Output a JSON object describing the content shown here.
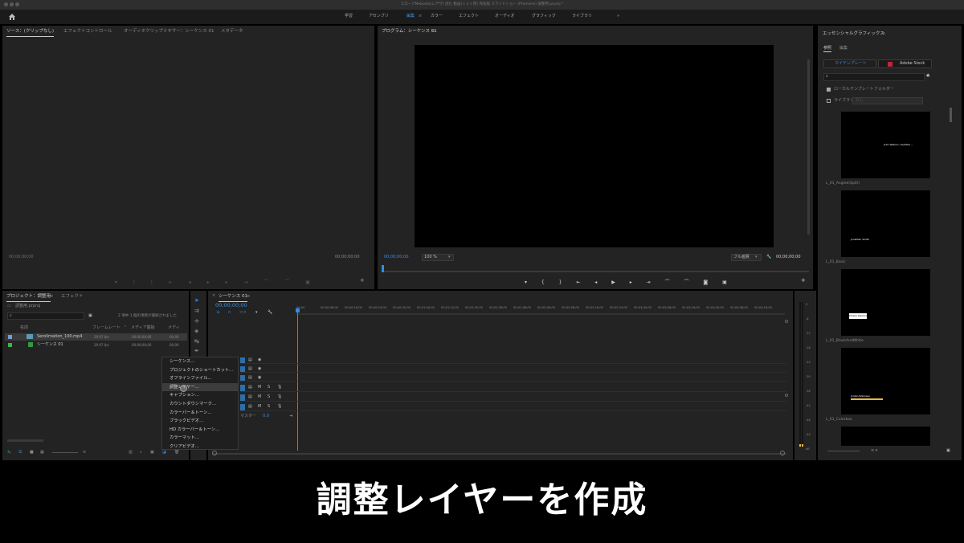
{
  "titlebar": {
    "title": "スローアMebodia(レデザ) 読む 動画(ｓｎｓ用) 完成版 スライドショー (Premiere) 調整用.prproj *"
  },
  "workspaces": {
    "items": [
      "学習",
      "アセンブリ",
      "編集",
      "カラー",
      "エフェクト",
      "オーディオ",
      "グラフィック",
      "ライブラリ"
    ],
    "more": "»"
  },
  "source_panel": {
    "tabs": [
      "ソース：(クリップなし)",
      "エフェクトコントロール",
      "オーディオクリップミキサー：シーケンス 01",
      "メタデータ"
    ],
    "timecode_left": "00;00;00;00",
    "timecode_right": "00;00;00;00"
  },
  "program_panel": {
    "title": "プログラム：シーケンス 01",
    "timecode_left": "00;00;00;00",
    "zoom": "100 %",
    "quality": "フル画質",
    "timecode_right": "00;00;00;00"
  },
  "project_panel": {
    "tabs": [
      "プロジェクト：調整用",
      "エフェクト"
    ],
    "file": "調整用.prproj",
    "search_placeholder": "",
    "status": "2 項中 1 個の項目が選択されました",
    "columns": [
      "名前",
      "フレームレート",
      "メディア開始",
      "メディ"
    ],
    "rows": [
      {
        "name": "Serolimation_100.mp4",
        "fps": "29.97 fps",
        "start": "00;00;00;00",
        "end": "00;00"
      },
      {
        "name": "シーケンス 01",
        "fps": "29.97 fps",
        "start": "00;00;00;00",
        "end": "00;00"
      }
    ]
  },
  "context_menu": {
    "items": [
      "シーケンス...",
      "プロジェクトのショートカット...",
      "オフラインファイル...",
      "調整レイヤー...",
      "キャプション...",
      "カウントダウンマーク...",
      "カラーバー＆トーン...",
      "ブラックビデオ...",
      "HD カラーバー＆トーン...",
      "カラーマット...",
      "クリアビデオ..."
    ],
    "highlighted_index": 3
  },
  "timeline": {
    "tab": "シーケンス 01",
    "timecode": "00;00;00;00",
    "ruler": [
      "00;00",
      "00;00;08;00",
      "00;00;16;00",
      "00;00;24;00",
      "00;00;32;00",
      "00;01;04;00",
      "00;01;12;00",
      "00;01;20;00",
      "00;01;28;00",
      "00;01;36;00",
      "00;02;00;00",
      "00;02;08;00",
      "00;02;16;00",
      "00;02;24;00",
      "00;03;00;00",
      "00;03;08;00",
      "00;03;16;00",
      "00;04;00;00",
      "00;04;08;00",
      "00;04;16;00"
    ],
    "master_label": "マスター",
    "master_value": "0.0",
    "meter_scale": [
      "0",
      "-6",
      "-12",
      "-18",
      "-24",
      "-30",
      "-36",
      "-42",
      "-48",
      "-54",
      "dB"
    ]
  },
  "essential_graphics": {
    "title": "エッセンシャルグラフィックス",
    "tabs": [
      "参照",
      "編集"
    ],
    "sub_tabs": [
      "マイテンプレート",
      "Adobe Stock"
    ],
    "local_folder_label": "ローカルテンプレートフォルダー",
    "library_label": "ライブラリ",
    "library_value": "なし",
    "templates": [
      "L_01_Angled(Split)",
      "L_01_Basic",
      "L_01_BlackAndWhite",
      "L_01_Colorbox"
    ],
    "thumb_texts": [
      "John Watson / Subtitle ...",
      "Jonathan Smith",
      "Chiara Santoro",
      "Jordan Robinson"
    ]
  },
  "caption": "調整レイヤーを作成",
  "colors": {
    "accent": "#2d8ceb",
    "panel": "#232323",
    "highlight_bar": "#e8b64c"
  }
}
